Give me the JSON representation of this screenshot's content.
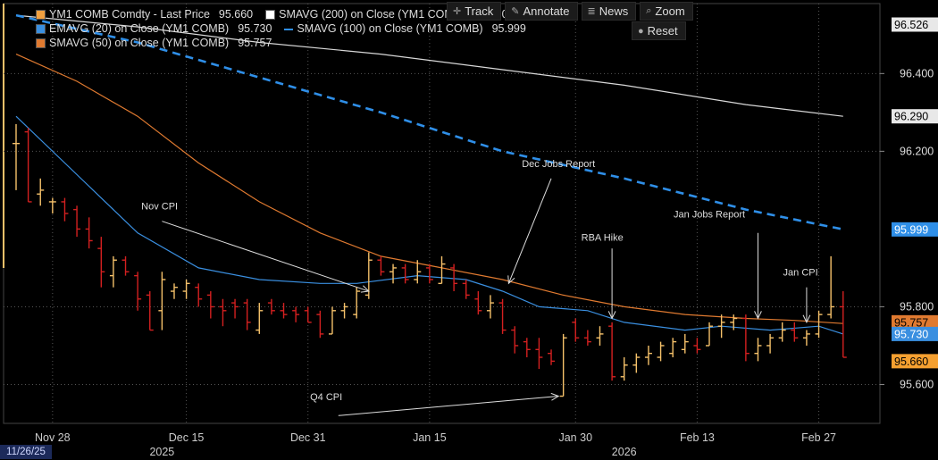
{
  "legend": {
    "items": [
      {
        "label": "YM1 COMB Comdty - Last Price",
        "value": "95.660",
        "color": "#f0a040"
      },
      {
        "label": "SMAVG (200)  on Close (YM1 COMB)",
        "value": "96.290",
        "color": "#e8e8e8"
      },
      {
        "label": "EMAVG (20)  on Close (YM1 COMB)",
        "value": "95.730",
        "color": "#3a8fe0"
      },
      {
        "label": "SMAVG (100)  on Close (YM1 COMB)",
        "value": "95.999",
        "color": "#2f8fe8"
      },
      {
        "label": "SMAVG (50)  on Close (YM1 COMB)",
        "value": "95.757",
        "color": "#e07a30"
      }
    ]
  },
  "toolbar": {
    "track": "Track",
    "annotate": "Annotate",
    "news": "News",
    "zoom": "Zoom",
    "reset": "Reset"
  },
  "footer": {
    "start_date": "11/26/25"
  },
  "chart_data": {
    "type": "ohlc",
    "colors": {
      "up": "#f5c16a",
      "down": "#d42020",
      "sma200": "#d8d8d8",
      "sma100": "#2f8fe8",
      "sma50": "#e07a30",
      "ema20": "#3a8fe0",
      "grid": "#555"
    },
    "ylim": [
      95.5,
      96.58
    ],
    "yticks": [
      "95.600",
      "95.800",
      "96.200",
      "96.400"
    ],
    "ytick_values": [
      95.6,
      95.8,
      96.2,
      96.4
    ],
    "grid_y": [
      95.6,
      95.8,
      96.2,
      96.4
    ],
    "xlim": [
      0,
      70
    ],
    "xticks": [
      {
        "x": 3,
        "label": "Nov 28"
      },
      {
        "x": 14,
        "label": "Dec 15"
      },
      {
        "x": 24,
        "label": "Dec 31"
      },
      {
        "x": 34,
        "label": "Jan 15"
      },
      {
        "x": 46,
        "label": "Jan 30"
      },
      {
        "x": 56,
        "label": "Feb 13"
      },
      {
        "x": 66,
        "label": "Feb 27"
      }
    ],
    "year_labels": [
      {
        "x": 12,
        "label": "2025"
      },
      {
        "x": 50,
        "label": "2026"
      }
    ],
    "candles": [
      {
        "x": 0,
        "o": 96.22,
        "h": 96.27,
        "l": 96.1,
        "c": 96.22
      },
      {
        "x": 1,
        "o": 96.25,
        "h": 96.26,
        "l": 96.07,
        "c": 96.07
      },
      {
        "x": 2,
        "o": 96.09,
        "h": 96.13,
        "l": 96.06,
        "c": 96.1
      },
      {
        "x": 3,
        "o": 96.07,
        "h": 96.08,
        "l": 96.04,
        "c": 96.07
      },
      {
        "x": 4,
        "o": 96.07,
        "h": 96.08,
        "l": 96.02,
        "c": 96.04
      },
      {
        "x": 5,
        "o": 96.05,
        "h": 96.06,
        "l": 95.98,
        "c": 96.0
      },
      {
        "x": 6,
        "o": 96.0,
        "h": 96.03,
        "l": 95.95,
        "c": 95.97
      },
      {
        "x": 7,
        "o": 95.95,
        "h": 95.98,
        "l": 95.85,
        "c": 95.89
      },
      {
        "x": 8,
        "o": 95.88,
        "h": 95.93,
        "l": 95.85,
        "c": 95.92
      },
      {
        "x": 9,
        "o": 95.92,
        "h": 95.93,
        "l": 95.88,
        "c": 95.89
      },
      {
        "x": 10,
        "o": 95.88,
        "h": 95.89,
        "l": 95.79,
        "c": 95.82
      },
      {
        "x": 11,
        "o": 95.83,
        "h": 95.84,
        "l": 95.74,
        "c": 95.74
      },
      {
        "x": 12,
        "o": 95.79,
        "h": 95.89,
        "l": 95.74,
        "c": 95.87
      },
      {
        "x": 13,
        "o": 95.84,
        "h": 95.86,
        "l": 95.82,
        "c": 95.85
      },
      {
        "x": 14,
        "o": 95.84,
        "h": 95.87,
        "l": 95.82,
        "c": 95.86
      },
      {
        "x": 15,
        "o": 95.85,
        "h": 95.86,
        "l": 95.8,
        "c": 95.82
      },
      {
        "x": 16,
        "o": 95.83,
        "h": 95.84,
        "l": 95.77,
        "c": 95.8
      },
      {
        "x": 17,
        "o": 95.8,
        "h": 95.82,
        "l": 95.75,
        "c": 95.79
      },
      {
        "x": 18,
        "o": 95.81,
        "h": 95.82,
        "l": 95.77,
        "c": 95.8
      },
      {
        "x": 19,
        "o": 95.81,
        "h": 95.82,
        "l": 95.74,
        "c": 95.76
      },
      {
        "x": 20,
        "o": 95.74,
        "h": 95.81,
        "l": 95.73,
        "c": 95.79
      },
      {
        "x": 21,
        "o": 95.81,
        "h": 95.82,
        "l": 95.78,
        "c": 95.79
      },
      {
        "x": 22,
        "o": 95.79,
        "h": 95.81,
        "l": 95.77,
        "c": 95.78
      },
      {
        "x": 23,
        "o": 95.79,
        "h": 95.8,
        "l": 95.76,
        "c": 95.78
      },
      {
        "x": 24,
        "o": 95.79,
        "h": 95.8,
        "l": 95.76,
        "c": 95.76
      },
      {
        "x": 25,
        "o": 95.78,
        "h": 95.79,
        "l": 95.72,
        "c": 95.73
      },
      {
        "x": 26,
        "o": 95.73,
        "h": 95.8,
        "l": 95.73,
        "c": 95.79
      },
      {
        "x": 27,
        "o": 95.79,
        "h": 95.81,
        "l": 95.77,
        "c": 95.8
      },
      {
        "x": 28,
        "o": 95.78,
        "h": 95.85,
        "l": 95.77,
        "c": 95.84
      },
      {
        "x": 29,
        "o": 95.83,
        "h": 95.94,
        "l": 95.82,
        "c": 95.92
      },
      {
        "x": 30,
        "o": 95.92,
        "h": 95.93,
        "l": 95.88,
        "c": 95.89
      },
      {
        "x": 31,
        "o": 95.89,
        "h": 95.91,
        "l": 95.86,
        "c": 95.9
      },
      {
        "x": 32,
        "o": 95.9,
        "h": 95.91,
        "l": 95.86,
        "c": 95.87
      },
      {
        "x": 33,
        "o": 95.87,
        "h": 95.92,
        "l": 95.86,
        "c": 95.89
      },
      {
        "x": 34,
        "o": 95.9,
        "h": 95.91,
        "l": 95.86,
        "c": 95.87
      },
      {
        "x": 35,
        "o": 95.86,
        "h": 95.93,
        "l": 95.86,
        "c": 95.91
      },
      {
        "x": 36,
        "o": 95.9,
        "h": 95.91,
        "l": 95.84,
        "c": 95.86
      },
      {
        "x": 37,
        "o": 95.86,
        "h": 95.87,
        "l": 95.82,
        "c": 95.83
      },
      {
        "x": 38,
        "o": 95.82,
        "h": 95.84,
        "l": 95.78,
        "c": 95.79
      },
      {
        "x": 39,
        "o": 95.79,
        "h": 95.83,
        "l": 95.77,
        "c": 95.81
      },
      {
        "x": 40,
        "o": 95.81,
        "h": 95.82,
        "l": 95.73,
        "c": 95.74
      },
      {
        "x": 41,
        "o": 95.74,
        "h": 95.75,
        "l": 95.68,
        "c": 95.7
      },
      {
        "x": 42,
        "o": 95.71,
        "h": 95.72,
        "l": 95.67,
        "c": 95.69
      },
      {
        "x": 43,
        "o": 95.69,
        "h": 95.72,
        "l": 95.64,
        "c": 95.67
      },
      {
        "x": 44,
        "o": 95.68,
        "h": 95.69,
        "l": 95.65,
        "c": 95.66
      },
      {
        "x": 45,
        "o": 95.57,
        "h": 95.73,
        "l": 95.57,
        "c": 95.72
      },
      {
        "x": 46,
        "o": 95.76,
        "h": 95.77,
        "l": 95.71,
        "c": 95.72
      },
      {
        "x": 47,
        "o": 95.72,
        "h": 95.74,
        "l": 95.7,
        "c": 95.71
      },
      {
        "x": 48,
        "o": 95.72,
        "h": 95.75,
        "l": 95.7,
        "c": 95.73
      },
      {
        "x": 49,
        "o": 95.75,
        "h": 95.76,
        "l": 95.61,
        "c": 95.62
      },
      {
        "x": 50,
        "o": 95.62,
        "h": 95.67,
        "l": 95.61,
        "c": 95.65
      },
      {
        "x": 51,
        "o": 95.65,
        "h": 95.68,
        "l": 95.63,
        "c": 95.67
      },
      {
        "x": 52,
        "o": 95.67,
        "h": 95.7,
        "l": 95.65,
        "c": 95.68
      },
      {
        "x": 53,
        "o": 95.67,
        "h": 95.71,
        "l": 95.66,
        "c": 95.7
      },
      {
        "x": 54,
        "o": 95.68,
        "h": 95.72,
        "l": 95.67,
        "c": 95.71
      },
      {
        "x": 55,
        "o": 95.69,
        "h": 95.73,
        "l": 95.68,
        "c": 95.71
      },
      {
        "x": 56,
        "o": 95.7,
        "h": 95.72,
        "l": 95.68,
        "c": 95.69
      },
      {
        "x": 57,
        "o": 95.7,
        "h": 95.76,
        "l": 95.7,
        "c": 95.75
      },
      {
        "x": 58,
        "o": 95.75,
        "h": 95.78,
        "l": 95.72,
        "c": 95.76
      },
      {
        "x": 59,
        "o": 95.76,
        "h": 95.78,
        "l": 95.74,
        "c": 95.77
      },
      {
        "x": 60,
        "o": 95.77,
        "h": 95.78,
        "l": 95.66,
        "c": 95.68
      },
      {
        "x": 61,
        "o": 95.68,
        "h": 95.72,
        "l": 95.66,
        "c": 95.7
      },
      {
        "x": 62,
        "o": 95.7,
        "h": 95.73,
        "l": 95.68,
        "c": 95.72
      },
      {
        "x": 63,
        "o": 95.72,
        "h": 95.76,
        "l": 95.71,
        "c": 95.74
      },
      {
        "x": 64,
        "o": 95.74,
        "h": 95.76,
        "l": 95.71,
        "c": 95.72
      },
      {
        "x": 65,
        "o": 95.72,
        "h": 95.74,
        "l": 95.7,
        "c": 95.73
      },
      {
        "x": 66,
        "o": 95.73,
        "h": 95.79,
        "l": 95.72,
        "c": 95.78
      },
      {
        "x": 67,
        "o": 95.78,
        "h": 95.93,
        "l": 95.77,
        "c": 95.8
      },
      {
        "x": 68,
        "o": 95.8,
        "h": 95.84,
        "l": 95.67,
        "c": 95.67
      }
    ],
    "sma200": [
      [
        0,
        96.55
      ],
      [
        10,
        96.52
      ],
      [
        20,
        96.48
      ],
      [
        30,
        96.45
      ],
      [
        40,
        96.41
      ],
      [
        50,
        96.37
      ],
      [
        60,
        96.32
      ],
      [
        68,
        96.29
      ]
    ],
    "sma100": [
      [
        0,
        96.55
      ],
      [
        10,
        96.48
      ],
      [
        20,
        96.39
      ],
      [
        30,
        96.3
      ],
      [
        40,
        96.2
      ],
      [
        50,
        96.13
      ],
      [
        60,
        96.05
      ],
      [
        68,
        95.999
      ]
    ],
    "sma50": [
      [
        0,
        96.45
      ],
      [
        5,
        96.38
      ],
      [
        10,
        96.29
      ],
      [
        15,
        96.17
      ],
      [
        20,
        96.07
      ],
      [
        25,
        95.99
      ],
      [
        30,
        95.93
      ],
      [
        35,
        95.9
      ],
      [
        40,
        95.87
      ],
      [
        45,
        95.83
      ],
      [
        50,
        95.8
      ],
      [
        55,
        95.78
      ],
      [
        60,
        95.77
      ],
      [
        64,
        95.765
      ],
      [
        68,
        95.757
      ]
    ],
    "ema20": [
      [
        0,
        96.29
      ],
      [
        5,
        96.14
      ],
      [
        10,
        95.99
      ],
      [
        15,
        95.9
      ],
      [
        20,
        95.87
      ],
      [
        25,
        95.86
      ],
      [
        28,
        95.86
      ],
      [
        33,
        95.88
      ],
      [
        37,
        95.87
      ],
      [
        40,
        95.84
      ],
      [
        43,
        95.8
      ],
      [
        47,
        95.79
      ],
      [
        50,
        95.76
      ],
      [
        55,
        95.74
      ],
      [
        58,
        95.75
      ],
      [
        62,
        95.74
      ],
      [
        66,
        95.75
      ],
      [
        68,
        95.73
      ]
    ],
    "annotations": [
      {
        "label": "Nov CPI",
        "lx": 11.8,
        "ly": 96.05,
        "from": [
          12,
          96.02
        ],
        "to": [
          29,
          95.84
        ]
      },
      {
        "label": "Dec Jobs Report",
        "lx": 44.6,
        "ly": 96.16,
        "from": [
          44,
          96.13
        ],
        "to": [
          40.5,
          95.86
        ]
      },
      {
        "label": "RBA Hike",
        "lx": 48.2,
        "ly": 95.97,
        "from": [
          49,
          95.95
        ],
        "to": [
          49,
          95.77
        ]
      },
      {
        "label": "Jan Jobs Report",
        "lx": 57,
        "ly": 96.03,
        "from": [
          61,
          95.99
        ],
        "to": [
          61,
          95.77
        ]
      },
      {
        "label": "Jan CPI",
        "lx": 64.5,
        "ly": 95.88,
        "from": [
          65,
          95.85
        ],
        "to": [
          65,
          95.76
        ]
      },
      {
        "label": "Q4 CPI",
        "lx": 25.5,
        "ly": 95.56,
        "from": [
          26.5,
          95.52
        ],
        "to": [
          44.6,
          95.57
        ]
      }
    ],
    "right_labels": [
      {
        "text": "96.526",
        "y": 96.526,
        "bg": "#e8e8e8",
        "fg": "#000"
      },
      {
        "text": "96.290",
        "y": 96.29,
        "bg": "#e8e8e8",
        "fg": "#000"
      },
      {
        "text": "95.999",
        "y": 95.999,
        "bg": "#2f8fe8",
        "fg": "#fff"
      },
      {
        "text": "95.757",
        "y": 95.76,
        "bg": "#e07a30",
        "fg": "#000"
      },
      {
        "text": "95.730",
        "y": 95.73,
        "bg": "#3a8fe0",
        "fg": "#fff"
      },
      {
        "text": "95.660",
        "y": 95.66,
        "bg": "#f5a030",
        "fg": "#000"
      }
    ]
  }
}
